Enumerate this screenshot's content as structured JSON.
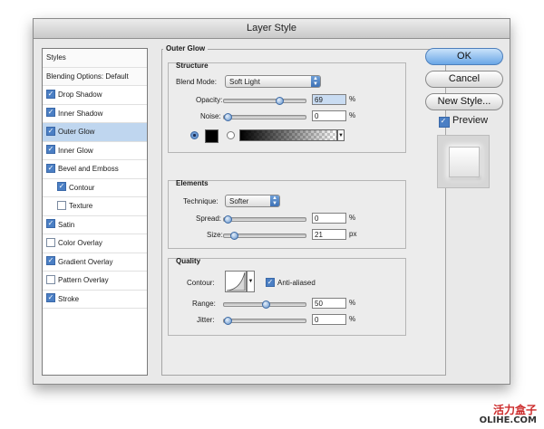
{
  "window": {
    "title": "Layer Style"
  },
  "styles_list": {
    "header": "Styles",
    "blending": "Blending Options: Default",
    "items": [
      {
        "label": "Drop Shadow",
        "checked": true
      },
      {
        "label": "Inner Shadow",
        "checked": true
      },
      {
        "label": "Outer Glow",
        "checked": true,
        "selected": true
      },
      {
        "label": "Inner Glow",
        "checked": true
      },
      {
        "label": "Bevel and Emboss",
        "checked": true
      },
      {
        "label": "Contour",
        "checked": true,
        "indent": true
      },
      {
        "label": "Texture",
        "checked": false,
        "indent": true
      },
      {
        "label": "Satin",
        "checked": true
      },
      {
        "label": "Color Overlay",
        "checked": false
      },
      {
        "label": "Gradient Overlay",
        "checked": true
      },
      {
        "label": "Pattern Overlay",
        "checked": false
      },
      {
        "label": "Stroke",
        "checked": true
      }
    ]
  },
  "outer_glow": {
    "title": "Outer Glow",
    "structure": {
      "title": "Structure",
      "blend_mode_label": "Blend Mode:",
      "blend_mode": "Soft Light",
      "opacity_label": "Opacity:",
      "opacity": "69",
      "opacity_fraction": 0.69,
      "noise_label": "Noise:",
      "noise": "0",
      "noise_fraction": 0,
      "percent": "%"
    },
    "elements": {
      "title": "Elements",
      "technique_label": "Technique:",
      "technique": "Softer",
      "spread_label": "Spread:",
      "spread": "0",
      "spread_fraction": 0,
      "size_label": "Size:",
      "size": "21",
      "size_fraction": 0.08,
      "px": "px",
      "percent": "%"
    },
    "quality": {
      "title": "Quality",
      "contour_label": "Contour:",
      "antialiased_label": "Anti-aliased",
      "antialiased": true,
      "range_label": "Range:",
      "range": "50",
      "range_fraction": 0.5,
      "jitter_label": "Jitter:",
      "jitter": "0",
      "jitter_fraction": 0,
      "percent": "%"
    }
  },
  "buttons": {
    "ok": "OK",
    "cancel": "Cancel",
    "new_style": "New Style..."
  },
  "preview": {
    "label": "Preview",
    "checked": true
  },
  "watermark": {
    "line1": "活力盒子",
    "line2": "OLIHE.COM"
  },
  "colors": {
    "accent": "#4b7fc4",
    "selected_row": "#bfd6ef",
    "watermark": "#cc2a2a"
  }
}
